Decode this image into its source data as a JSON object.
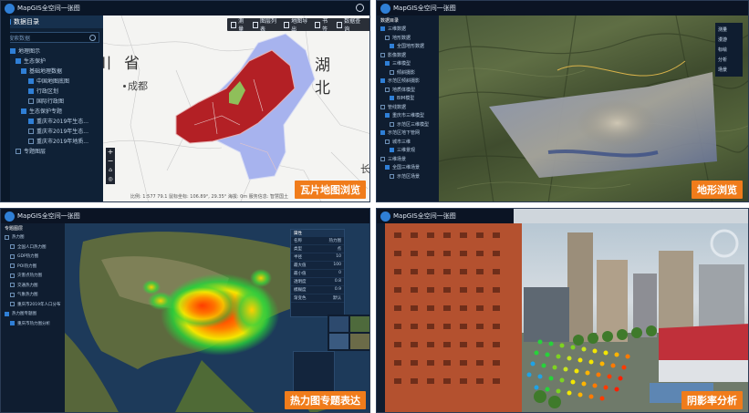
{
  "tl": {
    "app_title": "MapGIS全空间一张图",
    "sidebar_title": "数据目录",
    "search_placeholder": "搜索数据",
    "tree": [
      {
        "label": "地理图示",
        "checked": true
      },
      {
        "label": "生态保护",
        "checked": true
      },
      {
        "label": "基础地理数据",
        "checked": true
      },
      {
        "label": "中国地图底图",
        "checked": true
      },
      {
        "label": "行政区划",
        "checked": true
      },
      {
        "label": "国际行政图",
        "checked": false
      },
      {
        "label": "生态保护专题",
        "checked": true
      },
      {
        "label": "重庆市2019年生态...",
        "checked": true
      },
      {
        "label": "重庆市2019年生态...",
        "checked": false
      },
      {
        "label": "重庆市2019年地质...",
        "checked": false
      },
      {
        "label": "专题图层",
        "checked": false
      }
    ],
    "toolbar": [
      "测量",
      "图层列表",
      "地图导出",
      "书签",
      "数据查询"
    ],
    "map_labels": {
      "province_left": "川省",
      "province_right": "湖北",
      "city": "成都",
      "city_small": "长"
    },
    "status_text": "比例: 1:577 79.1 鼠标坐标: 106.89°, 29.35° 海拔: 0m 服务信息: 智慧国土",
    "caption": "瓦片地图浏览",
    "colors": {
      "red": "#b32025",
      "blue": "#a7b3ee",
      "green": "#8fbf5a",
      "caption": "#f07c1b"
    }
  },
  "tr": {
    "app_title": "MapGIS全空间一张图",
    "sidebar_title": "数据目录",
    "tree": [
      "三维数据",
      "地形数据",
      "全国地形数据",
      "影像数据",
      "三维模型",
      "倾斜摄影",
      "示范区倾斜摄影",
      "地质体模型",
      "BIM模型",
      "管线数据",
      "重庆市三维模型",
      "示范区三维模型",
      "示范区地下管网",
      "城市三维",
      "三维景观",
      "三维场景",
      "全国三维场景",
      "示范区场景"
    ],
    "right_tools": [
      "测量",
      "漫游",
      "标绘",
      "分析",
      "场景"
    ],
    "caption": "地形浏览"
  },
  "bl": {
    "app_title": "MapGIS全空间一张图",
    "sidebar_title": "专题图层",
    "tree": [
      "热力图",
      "全国人口热力图",
      "GDP热力图",
      "POI热力图",
      "灾害点热力图",
      "交通热力图",
      "气象热力图",
      "重庆市2019年人口分布",
      "热力图专题图",
      "重庆市热力图分析"
    ],
    "props_title": "属性",
    "props": [
      {
        "k": "名称",
        "v": "热力图"
      },
      {
        "k": "类型",
        "v": "点"
      },
      {
        "k": "半径",
        "v": "10"
      },
      {
        "k": "最大值",
        "v": "100"
      },
      {
        "k": "最小值",
        "v": "0"
      },
      {
        "k": "透明度",
        "v": "0.8"
      },
      {
        "k": "模糊度",
        "v": "0.9"
      },
      {
        "k": "渐变色",
        "v": "默认"
      }
    ],
    "caption": "热力图专题表达"
  },
  "br": {
    "app_title": "MapGIS全空间一张图",
    "caption": "阴影率分析"
  }
}
